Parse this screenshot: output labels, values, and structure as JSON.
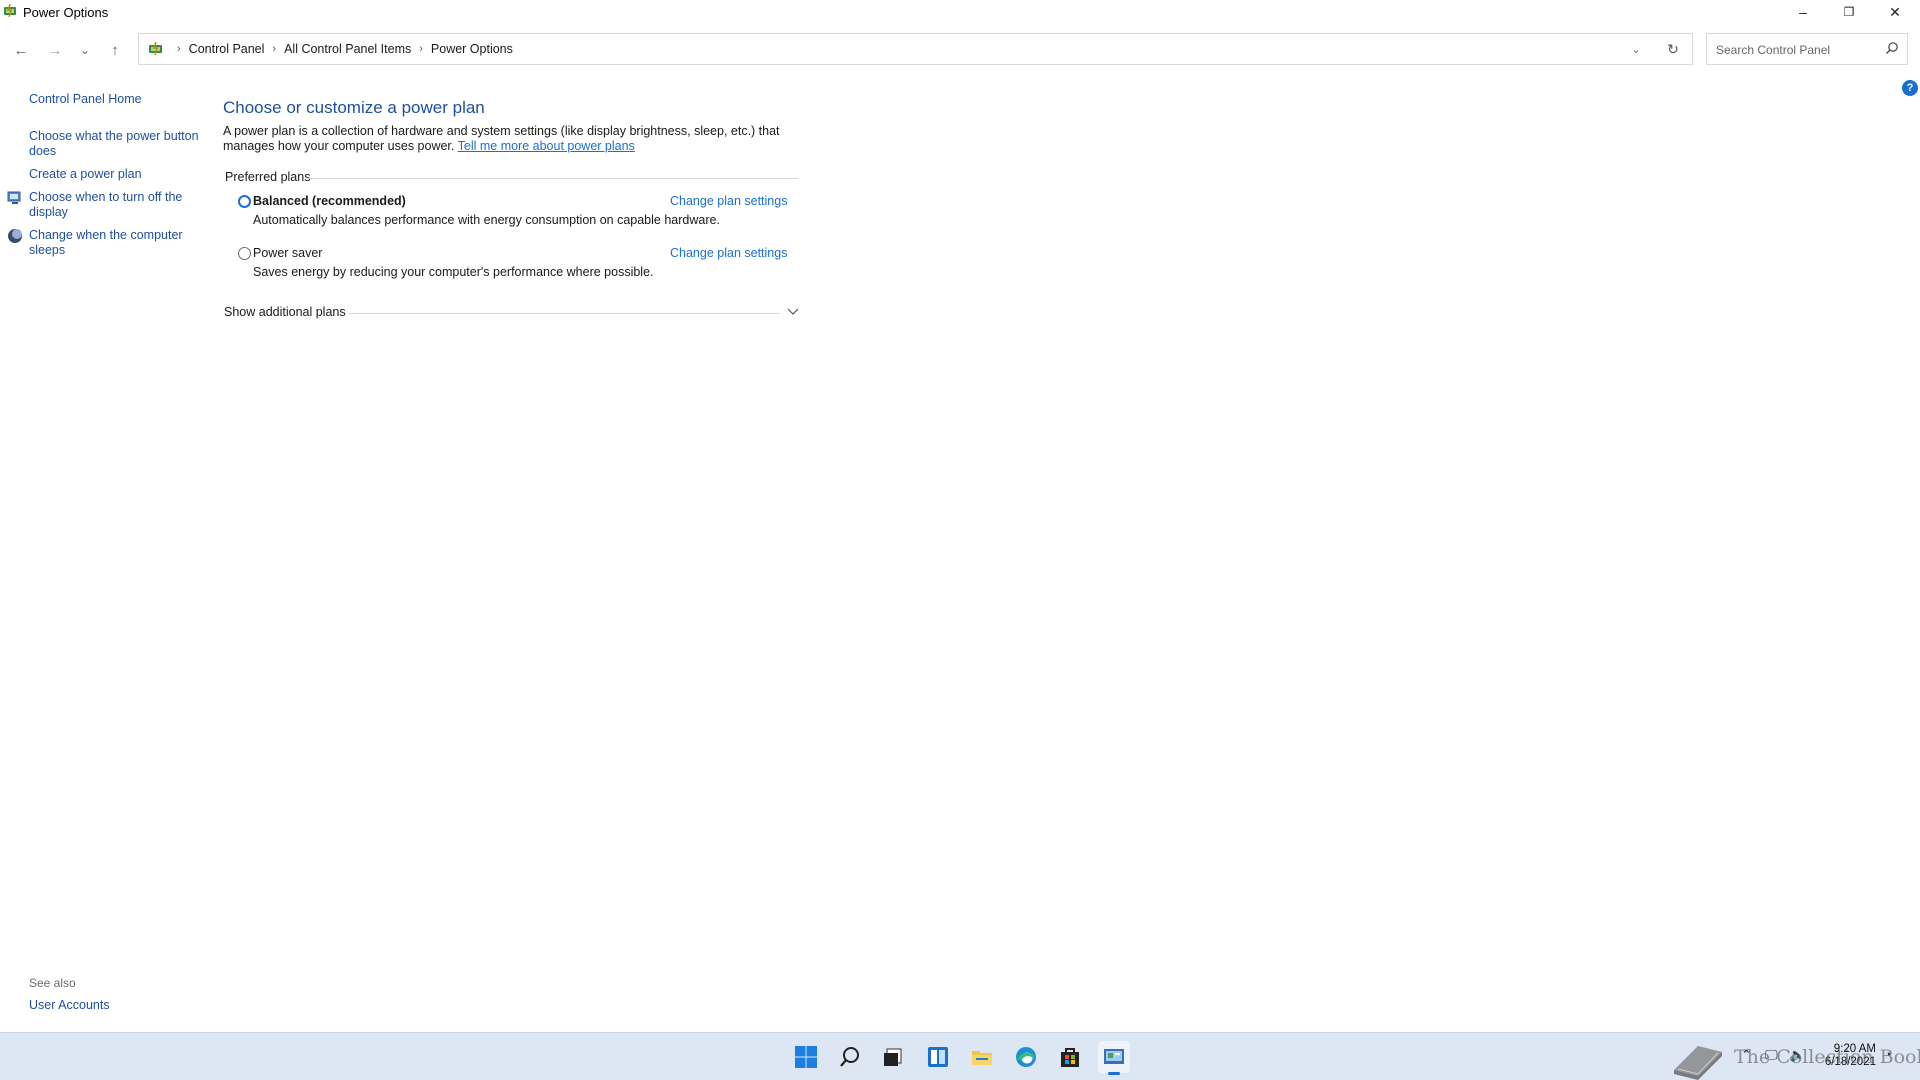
{
  "window": {
    "title": "Power Options",
    "minimize_glyph": "–",
    "restore_glyph": "❐",
    "close_glyph": "✕"
  },
  "nav": {
    "back_glyph": "←",
    "forward_glyph": "→",
    "recent_glyph": "⌄",
    "up_glyph": "↑"
  },
  "address": {
    "crumbs": [
      "Control Panel",
      "All Control Panel Items",
      "Power Options"
    ],
    "separator": "›",
    "dropdown_glyph": "⌄",
    "refresh_glyph": "↻"
  },
  "search": {
    "placeholder": "Search Control Panel"
  },
  "help": {
    "glyph": "?"
  },
  "sidebar": {
    "items": [
      "Control Panel Home",
      "Choose what the power button does",
      "Create a power plan",
      "Choose when to turn off the display",
      "Change when the computer sleeps"
    ],
    "see_also_label": "See also",
    "see_also_items": [
      "User Accounts"
    ]
  },
  "main": {
    "title": "Choose or customize a power plan",
    "intro_text": "A power plan is a collection of hardware and system settings (like display brightness, sleep, etc.) that manages how your computer uses power.",
    "intro_link": "Tell me more about power plans",
    "preferred_label": "Preferred plans",
    "plans": [
      {
        "name": "Balanced (recommended)",
        "description": "Automatically balances performance with energy consumption on capable hardware.",
        "link": "Change plan settings",
        "selected": true
      },
      {
        "name": "Power saver",
        "description": "Saves energy by reducing your computer's performance where possible.",
        "link": "Change plan settings",
        "selected": false
      }
    ],
    "show_additional": "Show additional plans"
  },
  "taskbar": {
    "icons": [
      "start-icon",
      "search-icon",
      "task-view-icon",
      "widgets-icon",
      "file-explorer-icon",
      "edge-icon",
      "store-icon",
      "control-panel-icon"
    ],
    "clock_time": "9:20 AM",
    "clock_date": "6/18/2021"
  },
  "watermark": {
    "text": "The Collection Book"
  },
  "colors": {
    "link": "#1e4f9c",
    "accent": "#1a6fd1",
    "taskbar": "#dde7f4"
  }
}
